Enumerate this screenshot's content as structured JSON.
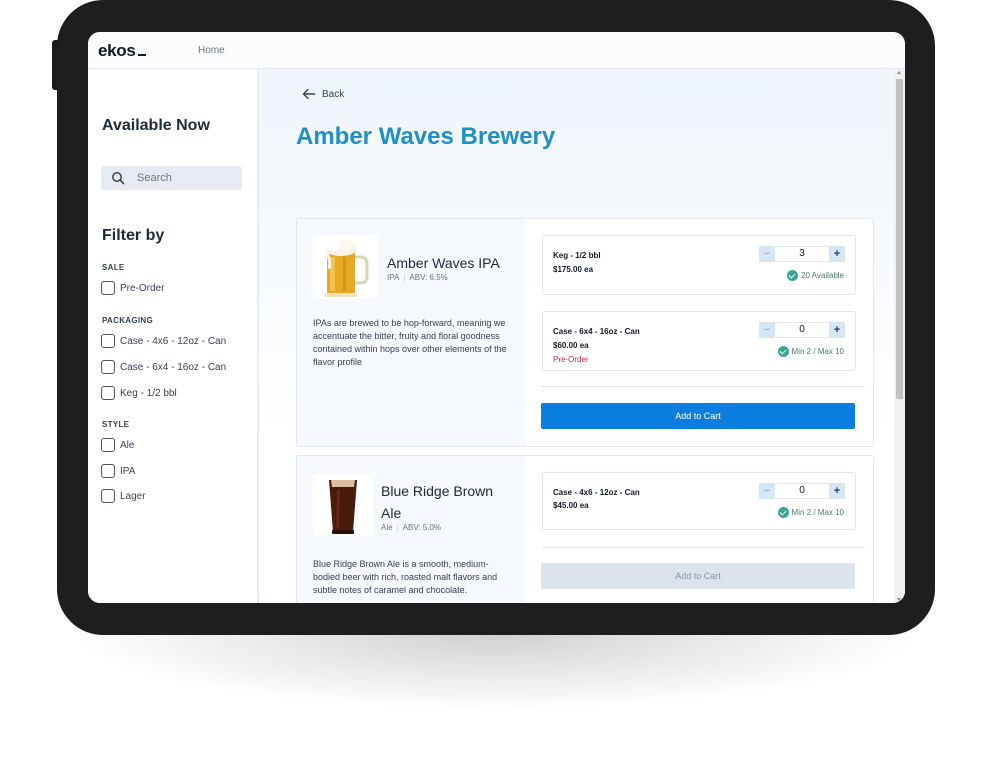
{
  "app": {
    "logo": "ekos",
    "nav_home": "Home"
  },
  "sidebar": {
    "title": "Available Now",
    "search_placeholder": "Search",
    "filter_title": "Filter by",
    "groups": [
      {
        "label": "SALE",
        "options": [
          "Pre-Order"
        ]
      },
      {
        "label": "PACKAGING",
        "options": [
          "Case - 4x6 - 12oz - Can",
          "Case - 6x4 - 16oz - Can",
          "Keg - 1/2 bbl"
        ]
      },
      {
        "label": "STYLE",
        "options": [
          "Ale",
          "IPA",
          "Lager"
        ]
      }
    ]
  },
  "main": {
    "back_label": "Back",
    "title": "Amber Waves Brewery",
    "products": [
      {
        "name": "Amber Waves IPA",
        "style": "IPA",
        "abv": "ABV: 6.5%",
        "description": "IPAs are brewed to be hop-forward, meaning we accentuate the bitter, fruity and floral goodness contained within hops over other elements of the flavor profile",
        "variants": [
          {
            "name": "Keg - 1/2 bbl",
            "price": "$175.00 ea",
            "note": "",
            "qty": "3",
            "availability": "20 Available"
          },
          {
            "name": "Case - 6x4 - 16oz - Can",
            "price": "$60.00 ea",
            "note": "Pre-Order",
            "qty": "0",
            "availability": "Min 2 / Max 10"
          }
        ],
        "cart_label": "Add to Cart",
        "cart_enabled": true
      },
      {
        "name_line1": "Blue Ridge Brown",
        "name_line2": "Ale",
        "style": "Ale",
        "abv": "ABV: 5.0%",
        "description": "Blue Ridge Brown Ale is a smooth, medium-bodied beer with rich, roasted malt flavors and subtle notes of caramel and chocolate.",
        "variants": [
          {
            "name": "Case - 4x6 - 12oz - Can",
            "price": "$45.00 ea",
            "qty": "0",
            "availability": "Min 2 / Max 10"
          }
        ],
        "cart_label": "Add to Cart",
        "cart_enabled": false
      }
    ]
  },
  "stepper": {
    "minus": "−",
    "plus": "+"
  },
  "colors": {
    "accent": "#0b7ee0",
    "title": "#1f8fc4",
    "preorder": "#d0234a",
    "available": "#3aa58e"
  },
  "icons": {
    "search": "search-icon",
    "back": "arrow-left-icon",
    "check": "check-circle-icon"
  }
}
